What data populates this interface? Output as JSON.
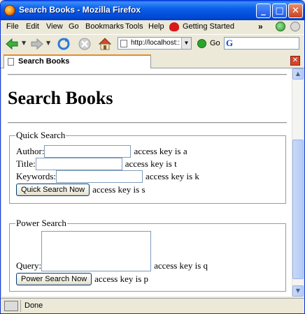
{
  "window": {
    "title": "Search Books - Mozilla Firefox",
    "minimize_glyph": "_",
    "maximize_glyph": "□",
    "close_glyph": "✕"
  },
  "menubar": {
    "items": [
      "File",
      "Edit",
      "View",
      "Go",
      "Bookmarks",
      "Tools",
      "Help"
    ],
    "bookmark": "Getting Started",
    "overflow_glyph": "»"
  },
  "navbar": {
    "url": "http://localhost::",
    "go_label": "Go",
    "search_engine_glyph": "G"
  },
  "tabs": [
    {
      "label": "Search Books"
    }
  ],
  "tab_close_glyph": "✕",
  "page": {
    "heading": "Search Books",
    "quick_search": {
      "legend": "Quick Search",
      "author_label": "Author:",
      "author_value": "",
      "author_note": "access key is a",
      "title_label": "Title:",
      "title_value": "",
      "title_note": "access key is t",
      "keywords_label": "Keywords:",
      "keywords_value": "",
      "keywords_note": "access key is k",
      "submit_label": "Quick Search Now",
      "submit_note": "access key is s"
    },
    "power_search": {
      "legend": "Power Search",
      "query_label": "Query:",
      "query_value": "",
      "query_note": "access key is q",
      "submit_label": "Power Search Now",
      "submit_note": "access key is p"
    }
  },
  "statusbar": {
    "text": "Done"
  },
  "scrollbar": {
    "up_glyph": "▲",
    "down_glyph": "▼"
  }
}
